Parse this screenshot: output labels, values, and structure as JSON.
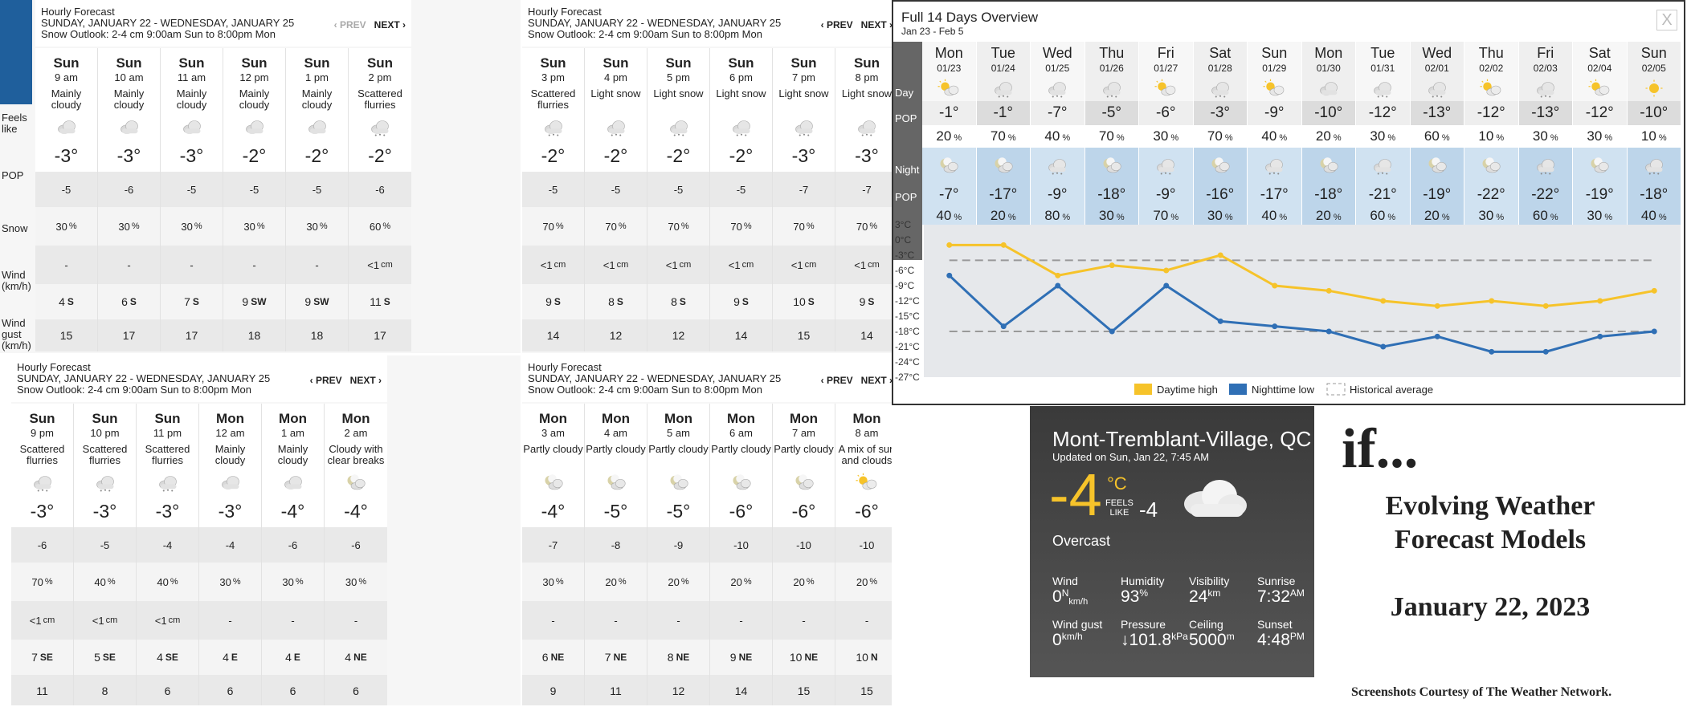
{
  "hourly_panels": [
    {
      "id": "p1",
      "title": "Hourly Forecast",
      "dates": "SUNDAY, JANUARY 22 - WEDNESDAY, JANUARY 25",
      "outlook": "Snow Outlook: 2-4 cm 9:00am Sun to 8:00pm Mon",
      "prev": "‹ PREV",
      "next": "NEXT ›",
      "prev_disabled": true,
      "row_labels": [
        "Feels like",
        "POP",
        "Snow",
        "Wind (km/h)",
        "Wind gust (km/h)"
      ],
      "columns": [
        {
          "day": "Sun",
          "time": "9 am",
          "cond": "Mainly cloudy",
          "icon": "cloud-icon",
          "temp": "-3°",
          "feels": "-5",
          "pop": "30",
          "snow": "-",
          "wind": "4",
          "dir": "S",
          "gust": "15"
        },
        {
          "day": "Sun",
          "time": "10 am",
          "cond": "Mainly cloudy",
          "icon": "cloud-icon",
          "temp": "-3°",
          "feels": "-6",
          "pop": "30",
          "snow": "-",
          "wind": "6",
          "dir": "S",
          "gust": "17"
        },
        {
          "day": "Sun",
          "time": "11 am",
          "cond": "Mainly cloudy",
          "icon": "cloud-icon",
          "temp": "-3°",
          "feels": "-5",
          "pop": "30",
          "snow": "-",
          "wind": "7",
          "dir": "S",
          "gust": "17"
        },
        {
          "day": "Sun",
          "time": "12 pm",
          "cond": "Mainly cloudy",
          "icon": "cloud-icon",
          "temp": "-2°",
          "feels": "-5",
          "pop": "30",
          "snow": "-",
          "wind": "9",
          "dir": "SW",
          "gust": "18"
        },
        {
          "day": "Sun",
          "time": "1 pm",
          "cond": "Mainly cloudy",
          "icon": "cloud-icon",
          "temp": "-2°",
          "feels": "-5",
          "pop": "30",
          "snow": "-",
          "wind": "9",
          "dir": "SW",
          "gust": "18"
        },
        {
          "day": "Sun",
          "time": "2 pm",
          "cond": "Scattered flurries",
          "icon": "snow-icon",
          "temp": "-2°",
          "feels": "-6",
          "pop": "60",
          "snow": "<1",
          "wind": "11",
          "dir": "S",
          "gust": "17"
        }
      ]
    },
    {
      "id": "p2",
      "title": "Hourly Forecast",
      "dates": "SUNDAY, JANUARY 22 - WEDNESDAY, JANUARY 25",
      "outlook": "Snow Outlook: 2-4 cm 9:00am Sun to 8:00pm Mon",
      "prev": "‹ PREV",
      "next": "NEXT ›",
      "prev_disabled": false,
      "columns": [
        {
          "day": "Sun",
          "time": "3 pm",
          "cond": "Scattered flurries",
          "icon": "snow-icon",
          "temp": "-2°",
          "feels": "-5",
          "pop": "70",
          "snow": "<1",
          "wind": "9",
          "dir": "S",
          "gust": "14"
        },
        {
          "day": "Sun",
          "time": "4 pm",
          "cond": "Light snow",
          "icon": "snow-icon",
          "temp": "-2°",
          "feels": "-5",
          "pop": "70",
          "snow": "<1",
          "wind": "8",
          "dir": "S",
          "gust": "12"
        },
        {
          "day": "Sun",
          "time": "5 pm",
          "cond": "Light snow",
          "icon": "snow-icon",
          "temp": "-2°",
          "feels": "-5",
          "pop": "70",
          "snow": "<1",
          "wind": "8",
          "dir": "S",
          "gust": "12"
        },
        {
          "day": "Sun",
          "time": "6 pm",
          "cond": "Light snow",
          "icon": "snow-icon",
          "temp": "-2°",
          "feels": "-5",
          "pop": "70",
          "snow": "<1",
          "wind": "9",
          "dir": "S",
          "gust": "14"
        },
        {
          "day": "Sun",
          "time": "7 pm",
          "cond": "Light snow",
          "icon": "snow-icon",
          "temp": "-3°",
          "feels": "-7",
          "pop": "70",
          "snow": "<1",
          "wind": "10",
          "dir": "S",
          "gust": "15"
        },
        {
          "day": "Sun",
          "time": "8 pm",
          "cond": "Light snow",
          "icon": "snow-icon",
          "temp": "-3°",
          "feels": "-7",
          "pop": "70",
          "snow": "<1",
          "wind": "9",
          "dir": "S",
          "gust": "14"
        }
      ]
    },
    {
      "id": "p3",
      "title": "Hourly Forecast",
      "dates": "SUNDAY, JANUARY 22 - WEDNESDAY, JANUARY 25",
      "outlook": "Snow Outlook: 2-4 cm 9:00am Sun to 8:00pm Mon",
      "prev": "‹ PREV",
      "next": "NEXT ›",
      "prev_disabled": false,
      "columns": [
        {
          "day": "Sun",
          "time": "9 pm",
          "cond": "Scattered flurries",
          "icon": "snow-icon",
          "temp": "-3°",
          "feels": "-6",
          "pop": "70",
          "snow": "<1",
          "wind": "7",
          "dir": "SE",
          "gust": "11"
        },
        {
          "day": "Sun",
          "time": "10 pm",
          "cond": "Scattered flurries",
          "icon": "snow-icon",
          "temp": "-3°",
          "feels": "-5",
          "pop": "40",
          "snow": "<1",
          "wind": "5",
          "dir": "SE",
          "gust": "8"
        },
        {
          "day": "Sun",
          "time": "11 pm",
          "cond": "Scattered flurries",
          "icon": "snow-icon",
          "temp": "-3°",
          "feels": "-4",
          "pop": "40",
          "snow": "<1",
          "wind": "4",
          "dir": "SE",
          "gust": "6"
        },
        {
          "day": "Mon",
          "time": "12 am",
          "cond": "Mainly cloudy",
          "icon": "cloud-icon",
          "temp": "-3°",
          "feels": "-4",
          "pop": "30",
          "snow": "-",
          "wind": "4",
          "dir": "E",
          "gust": "6"
        },
        {
          "day": "Mon",
          "time": "1 am",
          "cond": "Mainly cloudy",
          "icon": "cloud-icon",
          "temp": "-4°",
          "feels": "-6",
          "pop": "30",
          "snow": "-",
          "wind": "4",
          "dir": "E",
          "gust": "6"
        },
        {
          "day": "Mon",
          "time": "2 am",
          "cond": "Cloudy with clear breaks",
          "icon": "moon-cloud-icon",
          "temp": "-4°",
          "feels": "-6",
          "pop": "30",
          "snow": "-",
          "wind": "4",
          "dir": "NE",
          "gust": "6"
        }
      ]
    },
    {
      "id": "p4",
      "title": "Hourly Forecast",
      "dates": "SUNDAY, JANUARY 22 - WEDNESDAY, JANUARY 25",
      "outlook": "Snow Outlook: 2-4 cm 9:00am Sun to 8:00pm Mon",
      "prev": "‹ PREV",
      "next": "NEXT ›",
      "prev_disabled": false,
      "columns": [
        {
          "day": "Mon",
          "time": "3 am",
          "cond": "Partly cloudy",
          "icon": "moon-cloud-icon",
          "temp": "-4°",
          "feels": "-7",
          "pop": "30",
          "snow": "-",
          "wind": "6",
          "dir": "NE",
          "gust": "9"
        },
        {
          "day": "Mon",
          "time": "4 am",
          "cond": "Partly cloudy",
          "icon": "moon-cloud-icon",
          "temp": "-5°",
          "feels": "-8",
          "pop": "20",
          "snow": "-",
          "wind": "7",
          "dir": "NE",
          "gust": "11"
        },
        {
          "day": "Mon",
          "time": "5 am",
          "cond": "Partly cloudy",
          "icon": "moon-cloud-icon",
          "temp": "-5°",
          "feels": "-9",
          "pop": "20",
          "snow": "-",
          "wind": "8",
          "dir": "NE",
          "gust": "12"
        },
        {
          "day": "Mon",
          "time": "6 am",
          "cond": "Partly cloudy",
          "icon": "moon-cloud-icon",
          "temp": "-6°",
          "feels": "-10",
          "pop": "20",
          "snow": "-",
          "wind": "9",
          "dir": "NE",
          "gust": "14"
        },
        {
          "day": "Mon",
          "time": "7 am",
          "cond": "Partly cloudy",
          "icon": "moon-cloud-icon",
          "temp": "-6°",
          "feels": "-10",
          "pop": "20",
          "snow": "-",
          "wind": "10",
          "dir": "NE",
          "gust": "15"
        },
        {
          "day": "Mon",
          "time": "8 am",
          "cond": "A mix of sun and clouds",
          "icon": "sun-cloud-icon",
          "temp": "-6°",
          "feels": "-10",
          "pop": "20",
          "snow": "-",
          "wind": "10",
          "dir": "N",
          "gust": "15"
        }
      ]
    }
  ],
  "units": {
    "pct": "%",
    "cm": "cm"
  },
  "overview": {
    "title": "Full 14 Days Overview",
    "range": "Jan 23 - Feb 5",
    "close": "X",
    "labels": {
      "day": "Day",
      "pop": "POP",
      "night": "Night",
      "pop2": "POP"
    },
    "days": [
      {
        "dn": "Mon",
        "date": "01/23",
        "day_icon": "sun-cloud-icon",
        "hi": "-1°",
        "pop_d": "20",
        "night_icon": "moon-cloud-icon",
        "lo": "-7°",
        "pop_n": "40"
      },
      {
        "dn": "Tue",
        "date": "01/24",
        "day_icon": "snow-icon",
        "hi": "-1°",
        "pop_d": "70",
        "night_icon": "moon-cloud-icon",
        "lo": "-17°",
        "pop_n": "20"
      },
      {
        "dn": "Wed",
        "date": "01/25",
        "day_icon": "snow-icon",
        "hi": "-7°",
        "pop_d": "40",
        "night_icon": "snow-icon",
        "lo": "-9°",
        "pop_n": "80"
      },
      {
        "dn": "Thu",
        "date": "01/26",
        "day_icon": "snow-icon",
        "hi": "-5°",
        "pop_d": "70",
        "night_icon": "moon-cloud-icon",
        "lo": "-18°",
        "pop_n": "30"
      },
      {
        "dn": "Fri",
        "date": "01/27",
        "day_icon": "sun-cloud-icon",
        "hi": "-6°",
        "pop_d": "30",
        "night_icon": "snow-icon",
        "lo": "-9°",
        "pop_n": "70"
      },
      {
        "dn": "Sat",
        "date": "01/28",
        "day_icon": "snow-icon",
        "hi": "-3°",
        "pop_d": "70",
        "night_icon": "moon-cloud-icon",
        "lo": "-16°",
        "pop_n": "30"
      },
      {
        "dn": "Sun",
        "date": "01/29",
        "day_icon": "sun-cloud-icon",
        "hi": "-9°",
        "pop_d": "40",
        "night_icon": "snow-icon",
        "lo": "-17°",
        "pop_n": "40"
      },
      {
        "dn": "Mon",
        "date": "01/30",
        "day_icon": "cloud-icon",
        "hi": "-10°",
        "pop_d": "20",
        "night_icon": "moon-cloud-icon",
        "lo": "-18°",
        "pop_n": "20"
      },
      {
        "dn": "Tue",
        "date": "01/31",
        "day_icon": "snow-icon",
        "hi": "-12°",
        "pop_d": "30",
        "night_icon": "snow-icon",
        "lo": "-21°",
        "pop_n": "60"
      },
      {
        "dn": "Wed",
        "date": "02/01",
        "day_icon": "snow-icon",
        "hi": "-13°",
        "pop_d": "60",
        "night_icon": "moon-cloud-icon",
        "lo": "-19°",
        "pop_n": "20"
      },
      {
        "dn": "Thu",
        "date": "02/02",
        "day_icon": "sun-cloud-icon",
        "hi": "-12°",
        "pop_d": "10",
        "night_icon": "moon-cloud-icon",
        "lo": "-22°",
        "pop_n": "30"
      },
      {
        "dn": "Fri",
        "date": "02/03",
        "day_icon": "snow-icon",
        "hi": "-13°",
        "pop_d": "30",
        "night_icon": "snow-icon",
        "lo": "-22°",
        "pop_n": "60"
      },
      {
        "dn": "Sat",
        "date": "02/04",
        "day_icon": "sun-cloud-icon",
        "hi": "-12°",
        "pop_d": "30",
        "night_icon": "moon-cloud-icon",
        "lo": "-19°",
        "pop_n": "30"
      },
      {
        "dn": "Sun",
        "date": "02/05",
        "day_icon": "sun-icon",
        "hi": "-10°",
        "pop_d": "10",
        "night_icon": "snow-icon",
        "lo": "-18°",
        "pop_n": "40"
      }
    ]
  },
  "chart_data": {
    "type": "line",
    "categories": [
      "01/23",
      "01/24",
      "01/25",
      "01/26",
      "01/27",
      "01/28",
      "01/29",
      "01/30",
      "01/31",
      "02/01",
      "02/02",
      "02/03",
      "02/04",
      "02/05"
    ],
    "series": [
      {
        "name": "Daytime high",
        "color": "#f6c32a",
        "values": [
          -1,
          -1,
          -7,
          -5,
          -6,
          -3,
          -9,
          -10,
          -12,
          -13,
          -12,
          -13,
          -12,
          -10
        ]
      },
      {
        "name": "Nighttime low",
        "color": "#2f6fb5",
        "values": [
          -7,
          -17,
          -9,
          -18,
          -9,
          -16,
          -17,
          -18,
          -21,
          -19,
          -22,
          -22,
          -19,
          -18
        ]
      },
      {
        "name": "Historical average",
        "color": "#999999",
        "values": [
          -4,
          -4,
          -4,
          -4,
          -4,
          -4,
          -4,
          -4,
          -4,
          -4,
          -4,
          -4,
          -4,
          -4
        ],
        "values_low": [
          -18,
          -18,
          -18,
          -18,
          -18,
          -18,
          -18,
          -18,
          -18,
          -18,
          -18,
          -18,
          -18,
          -18
        ]
      }
    ],
    "yticks": [
      "3°C",
      "0°C",
      "-3°C",
      "-6°C",
      "-9°C",
      "-12°C",
      "-15°C",
      "-18°C",
      "-21°C",
      "-24°C",
      "-27°C"
    ],
    "ylim": [
      -27,
      3
    ],
    "legend_position": "bottom"
  },
  "current": {
    "location": "Mont-Tremblant-Village, QC",
    "updated": "Updated on Sun, Jan 22, 7:45 AM",
    "temp": "-4",
    "unit": "°C",
    "feels_label_1": "FEELS",
    "feels_label_2": "LIKE",
    "feels": "-4",
    "condition": "Overcast",
    "stats": [
      {
        "label": "Wind",
        "value": "0",
        "sup": "N",
        "sub": "km/h"
      },
      {
        "label": "Humidity",
        "value": "93",
        "sup": "%",
        "sub": ""
      },
      {
        "label": "Visibility",
        "value": "24",
        "sup": "km",
        "sub": ""
      },
      {
        "label": "Sunrise",
        "value": "7:32",
        "sup": "AM",
        "sub": ""
      },
      {
        "label": "Wind gust",
        "value": "0",
        "sup": "km/h",
        "sub": ""
      },
      {
        "label": "Pressure",
        "value": "↓101.8",
        "sup": "kPa",
        "sub": ""
      },
      {
        "label": "Ceiling",
        "value": "5000",
        "sup": "m",
        "sub": ""
      },
      {
        "label": "Sunset",
        "value": "4:48",
        "sup": "PM",
        "sub": ""
      }
    ]
  },
  "title_card": {
    "if": "if...",
    "line1": "Evolving Weather",
    "line2": "Forecast Models",
    "date": "January 22, 2023",
    "courtesy": "Screenshots Courtesy of The Weather Network."
  }
}
